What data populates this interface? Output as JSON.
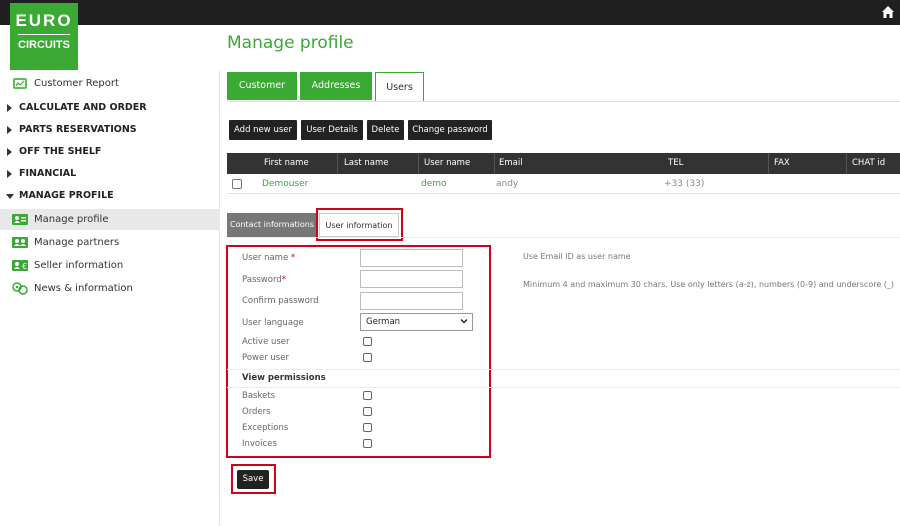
{
  "logo": {
    "line1": "EURO",
    "line2": "CIRCUITS"
  },
  "sidebar": {
    "customer_report": "Customer Report",
    "categories": [
      "CALCULATE AND ORDER",
      "PARTS RESERVATIONS",
      "OFF THE SHELF",
      "FINANCIAL",
      "MANAGE PROFILE"
    ],
    "items": [
      "Manage profile",
      "Manage partners",
      "Seller information",
      "News & information"
    ]
  },
  "page": {
    "title": "Manage profile",
    "tabs": [
      "Customer",
      "Addresses",
      "Users"
    ],
    "buttons": [
      "Add new user",
      "User Details",
      "Delete",
      "Change password"
    ]
  },
  "table": {
    "columns": [
      "First name",
      "Last name",
      "User name",
      "Email",
      "TEL",
      "FAX",
      "CHAT id"
    ],
    "row": {
      "first_name": "Demouser",
      "last_name": "",
      "user_name": "demo",
      "email": "andy",
      "tel": "+33 (33)",
      "fax": "",
      "chat": ""
    }
  },
  "subtabs": [
    "Contact informations",
    "User information"
  ],
  "form": {
    "user_name": "User name",
    "password": "Password",
    "required_mark": "*",
    "confirm_password": "Confirm password",
    "user_language": "User language",
    "language_value": "German",
    "active_user": "Active user",
    "power_user": "Power user",
    "view_permissions": "View permissions",
    "baskets": "Baskets",
    "orders": "Orders",
    "exceptions": "Exceptions",
    "invoices": "Invoices"
  },
  "hints": {
    "user_name": "Use Email ID as user name",
    "password": "Minimum 4 and maximum 30 chars. Use only letters (a-z), numbers (0-9) and underscore (_)"
  },
  "save_label": "Save",
  "colors": {
    "brand_green": "#3aaa35",
    "highlight_red": "#d0021b",
    "dark": "#222222"
  },
  "icons": [
    "home-icon",
    "report-icon",
    "profile-icon",
    "partners-icon",
    "seller-icon",
    "news-icon",
    "chevron-down-icon"
  ]
}
